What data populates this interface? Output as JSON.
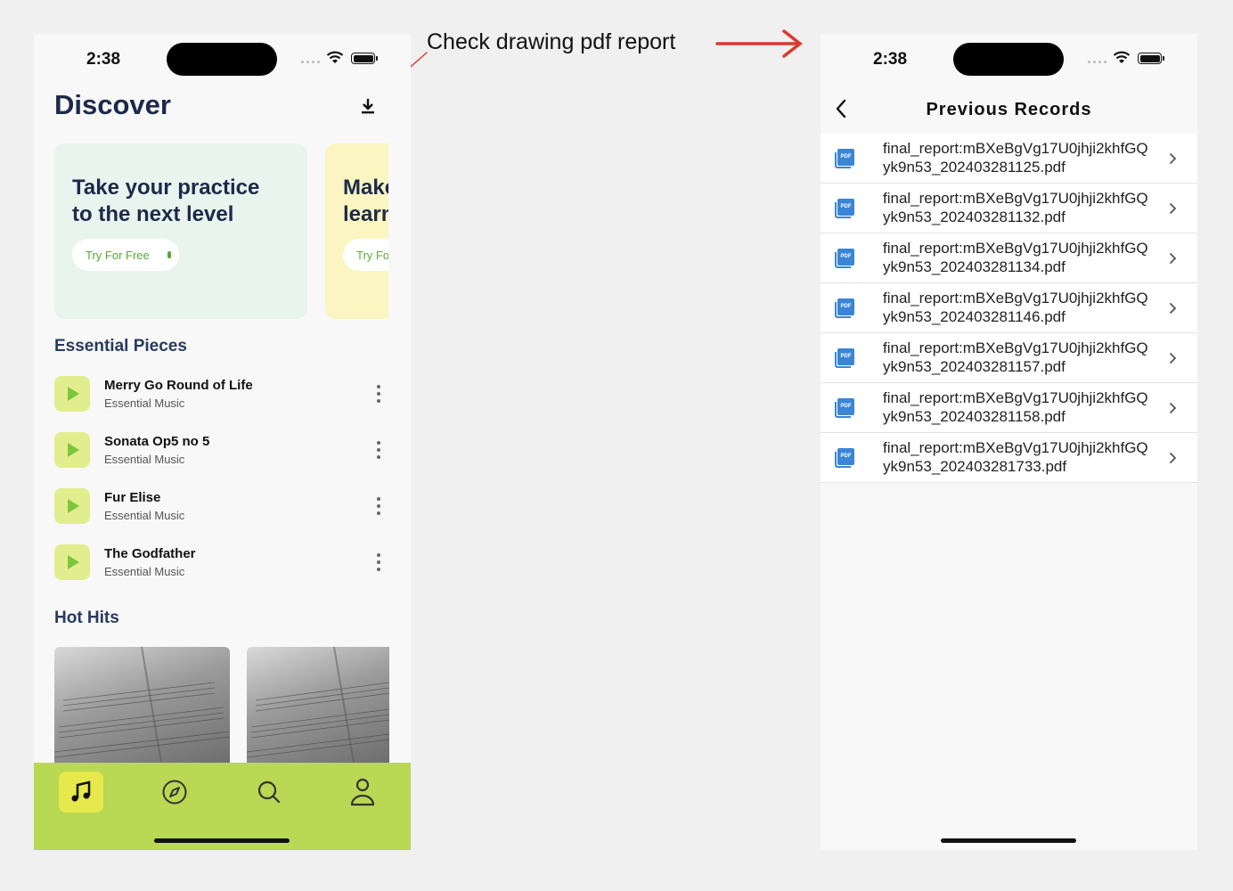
{
  "annotation": {
    "text": "Check drawing pdf report",
    "arrow_color": "#d83a2f"
  },
  "left_screen": {
    "status": {
      "time": "2:38"
    },
    "title": "Discover",
    "download_icon": "download-icon",
    "promos": [
      {
        "text_line1": "Take your practice",
        "text_line2": "to the next level",
        "button": "Try For Free",
        "color": "#e9f4ee"
      },
      {
        "text_line1": "Make",
        "text_line2": "learn",
        "button": "Try Fo",
        "color": "#fbf5c2"
      }
    ],
    "essential_title": "Essential Pieces",
    "tracks": [
      {
        "title": "Merry Go Round of Life",
        "subtitle": "Essential Music"
      },
      {
        "title": "Sonata Op5 no 5",
        "subtitle": "Essential Music"
      },
      {
        "title": "Fur Elise",
        "subtitle": "Essential Music"
      },
      {
        "title": "The Godfather",
        "subtitle": "Essential Music"
      }
    ],
    "hot_hits_title": "Hot Hits",
    "nav": [
      "music-icon",
      "compass-icon",
      "search-icon",
      "user-icon"
    ],
    "nav_color": "#b9d853",
    "nav_active_color": "#e6e84b"
  },
  "right_screen": {
    "status": {
      "time": "2:38"
    },
    "title": "Previous Records",
    "records": [
      "final_report:mBXeBgVg17U0jhji2khfGQyk9n53_202403281125.pdf",
      "final_report:mBXeBgVg17U0jhji2khfGQyk9n53_202403281132.pdf",
      "final_report:mBXeBgVg17U0jhji2khfGQyk9n53_202403281134.pdf",
      "final_report:mBXeBgVg17U0jhji2khfGQyk9n53_202403281146.pdf",
      "final_report:mBXeBgVg17U0jhji2khfGQyk9n53_202403281157.pdf",
      "final_report:mBXeBgVg17U0jhji2khfGQyk9n53_202403281158.pdf",
      "final_report:mBXeBgVg17U0jhji2khfGQyk9n53_202403281733.pdf"
    ],
    "pdf_icon_label": "PDF",
    "pdf_icon_color": "#3a85d6"
  }
}
